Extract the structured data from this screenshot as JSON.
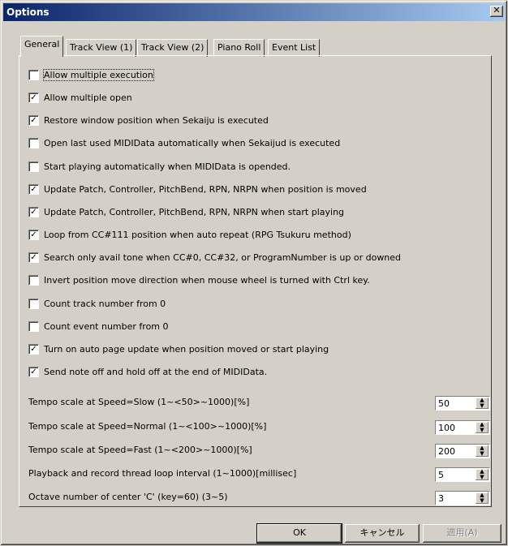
{
  "window": {
    "title": "Options",
    "close_glyph": "✕"
  },
  "tabs": [
    {
      "label": "General",
      "active": true
    },
    {
      "label": "Track View (1)",
      "active": false
    },
    {
      "label": "Track View (2)",
      "active": false
    },
    {
      "label": "Piano Roll",
      "active": false
    },
    {
      "label": "Event List",
      "active": false
    }
  ],
  "options": [
    {
      "label": "Allow multiple execution",
      "checked": false
    },
    {
      "label": "Allow multiple open",
      "checked": true
    },
    {
      "label": "Restore window position when Sekaiju is executed",
      "checked": true
    },
    {
      "label": "Open last used MIDIData automatically when Sekaijud is executed",
      "checked": false
    },
    {
      "label": "Start playing automatically when MIDIData is opended.",
      "checked": false
    },
    {
      "label": "Update Patch, Controller, PitchBend, RPN, NRPN when position is moved",
      "checked": true
    },
    {
      "label": "Update Patch, Controller, PitchBend, RPN, NRPN when start playing",
      "checked": true
    },
    {
      "label": "Loop from CC#111 position when auto repeat (RPG Tsukuru method)",
      "checked": true
    },
    {
      "label": "Search only avail tone when CC#0, CC#32, or ProgramNumber is up or downed",
      "checked": true
    },
    {
      "label": "Invert position move direction when mouse wheel is turned with Ctrl key.",
      "checked": false
    },
    {
      "label": "Count track number from 0",
      "checked": false
    },
    {
      "label": "Count event number from 0",
      "checked": false
    },
    {
      "label": "Turn on auto page update when position moved or start playing",
      "checked": true
    },
    {
      "label": "Send note off and hold off at the end of MIDIData.",
      "checked": true
    }
  ],
  "fields": [
    {
      "label": "Tempo scale at Speed=Slow (1~<50>~1000)[%]",
      "value": "50"
    },
    {
      "label": "Tempo scale at Speed=Normal (1~<100>~1000)[%]",
      "value": "100"
    },
    {
      "label": "Tempo scale at Speed=Fast (1~<200>~1000)[%]",
      "value": "200"
    },
    {
      "label": "Playback and record thread loop interval (1~1000)[millisec]",
      "value": "5"
    },
    {
      "label": "Octave number of center 'C' (key=60) (3~5)",
      "value": "3"
    }
  ],
  "buttons": {
    "ok": "OK",
    "cancel": "キャンセル",
    "apply": "適用(A)"
  },
  "glyphs": {
    "check": "✓",
    "spin_up": "▲",
    "spin_down": "▼"
  }
}
